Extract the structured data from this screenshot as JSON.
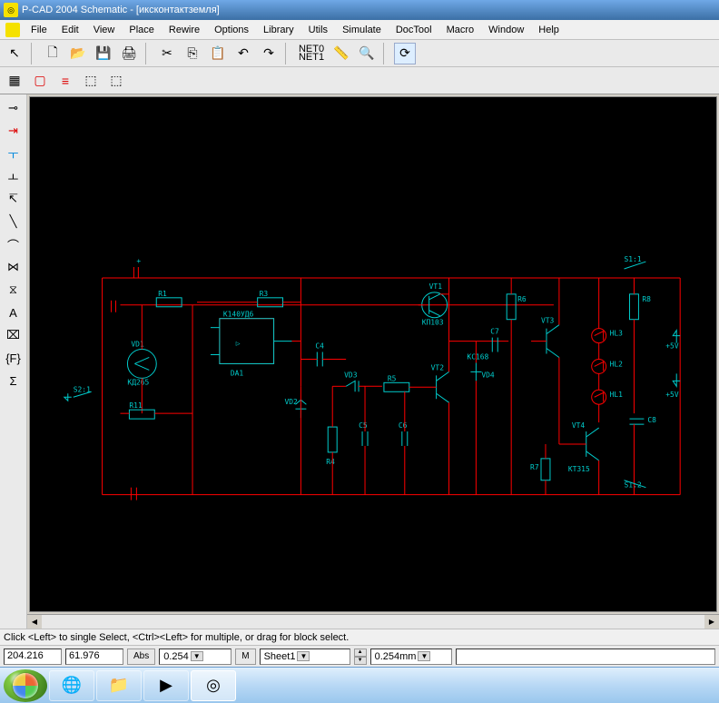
{
  "title": "P-CAD 2004 Schematic - [иксконтактземля]",
  "menu": [
    "File",
    "Edit",
    "View",
    "Place",
    "Rewire",
    "Options",
    "Library",
    "Utils",
    "Simulate",
    "DocTool",
    "Macro",
    "Window",
    "Help"
  ],
  "toolbar1": {
    "select": "↖",
    "new": "🗋",
    "open": "📂",
    "save": "💾",
    "print": "🖨",
    "cut": "✂",
    "copy": "⎘",
    "paste": "📋",
    "undo": "↶",
    "redo": "↷",
    "net0": "NET0",
    "net1": "NET1",
    "meas": "📏",
    "zoom": "🔍",
    "refresh": "⟳"
  },
  "toolbar2": {
    "grid": "▦",
    "box": "▢",
    "list": "≡",
    "comp1": "⬚",
    "comp2": "⬚"
  },
  "sidetools": [
    "⊸",
    "⇥",
    "ㅜ",
    "ㅗ",
    "↸",
    "╲",
    "⌒",
    "⋈",
    "⧖",
    "A",
    "⌧",
    "{F}",
    "Σ"
  ],
  "schematic_labels": {
    "vd1": "VD1",
    "da1": "DA1",
    "k140": "К140УД6",
    "r1": "R1",
    "r3": "R3",
    "r11": "R11",
    "c4": "C4",
    "vd3": "VD3",
    "r5": "R5",
    "vt2": "VT2",
    "vt1": "VT1",
    "kp103": "КП103",
    "c7": "C7",
    "r6": "R6",
    "vd4": "VD4",
    "kc168": "КС168",
    "c5": "C5",
    "c6": "C6",
    "r4": "R4",
    "vd2": "VD2",
    "vt3": "VT3",
    "c8": "C8",
    "vt4": "VT4",
    "r7": "R7",
    "kd265": "КД265",
    "hl1": "HL1",
    "hl2": "HL2",
    "hl3": "HL3",
    "r8": "R8",
    "s1_1": "S1:1",
    "s1_2": "S1:2",
    "s2_1": "S2:1",
    "plus5": "+5V",
    "kt315": "КТ315"
  },
  "status_hint": "Click <Left> to single Select, <Ctrl><Left> for multiple, or drag for block select.",
  "coords": {
    "x": "204.216",
    "y": "61.976"
  },
  "abs_btn": "Abs",
  "grid_val": "0.254",
  "m_btn": "M",
  "sheet": "Sheet1",
  "units": "0.254mm",
  "scrollbar": {
    "left": "◀",
    "right": "▶"
  }
}
